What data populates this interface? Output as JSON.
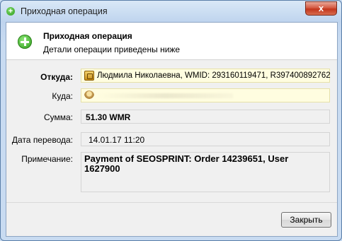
{
  "window": {
    "title": "Приходная операция",
    "close_glyph": "x"
  },
  "header": {
    "title": "Приходная операция",
    "subtitle": "Детали операции приведены ниже"
  },
  "fields": {
    "from": {
      "label": "Откуда:",
      "value": "Людмила Николаевна, WMID: 293160119471, R397400892762",
      "icon": "wallet-icon"
    },
    "to": {
      "label": "Куда:",
      "value": "",
      "icon": "person-icon"
    },
    "amount": {
      "label": "Сумма:",
      "value": "51.30 WMR"
    },
    "date": {
      "label": "Дата перевода:",
      "value": "14.01.17 11:20"
    },
    "note": {
      "label": "Примечание:",
      "value": "Payment of SEOSPRINT: Order 14239651, User 1627900"
    }
  },
  "buttons": {
    "close_label": "Закрыть"
  }
}
